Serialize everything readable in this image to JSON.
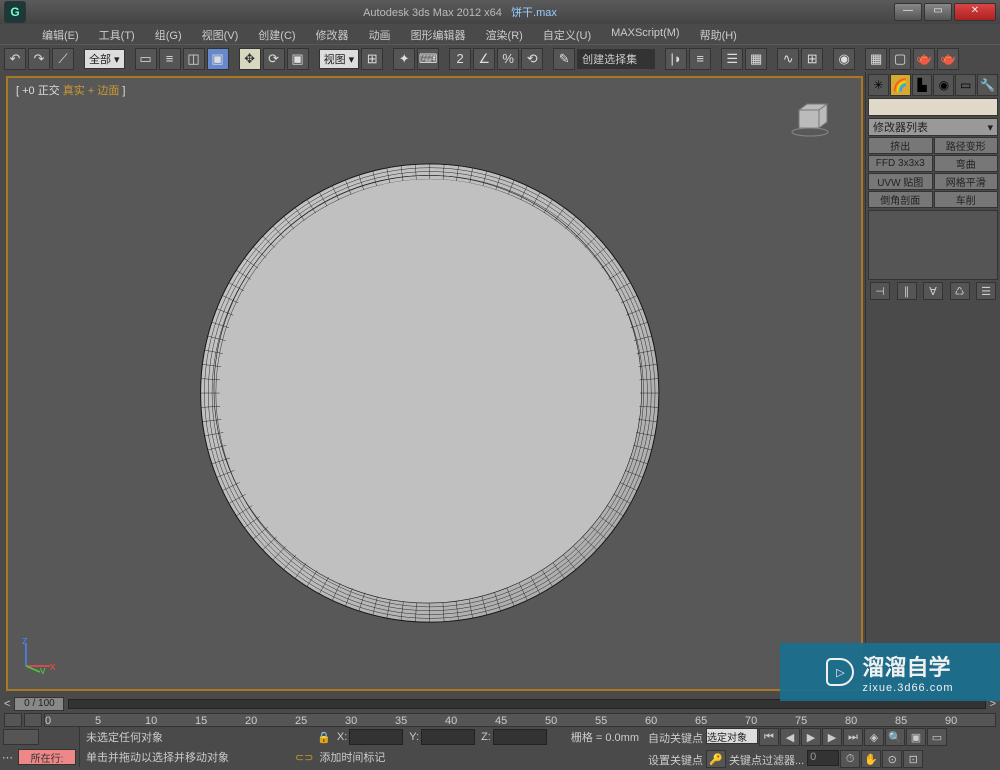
{
  "title": {
    "app": "Autodesk 3ds Max  2012 x64",
    "file": "饼干.max"
  },
  "menu": [
    "编辑(E)",
    "工具(T)",
    "组(G)",
    "视图(V)",
    "创建(C)",
    "修改器",
    "动画",
    "图形编辑器",
    "渲染(R)",
    "自定义(U)",
    "MAXScript(M)",
    "帮助(H)"
  ],
  "toolbar": {
    "filter_label": "全部 ▾",
    "viewtype_label": "视图 ▾",
    "selset_label": "创建选择集",
    "selset_dark": true
  },
  "viewport": {
    "label_prefix": "[ +0 正交  ",
    "label_gold": "真实 + 边面",
    "label_suffix": " ]"
  },
  "panel": {
    "list_header": "修改器列表",
    "mods": [
      "挤出",
      "路径变形",
      "FFD 3x3x3",
      "弯曲",
      "UVW 贴图",
      "网格平滑",
      "倒角剖面",
      "车削"
    ]
  },
  "time": {
    "slider_text": "0 / 100"
  },
  "ruler_ticks": [
    "0",
    "5",
    "10",
    "15",
    "20",
    "25",
    "30",
    "35",
    "40",
    "45",
    "50",
    "55",
    "60",
    "65",
    "70",
    "75",
    "80",
    "85",
    "90"
  ],
  "status": {
    "prompt1": "未选定任何对象",
    "prompt2": "单击并拖动以选择并移动对象",
    "add_tag": "添加时间标记",
    "x": "X:",
    "y": "Y:",
    "z": "Z:",
    "grid_label": "栅格 = 0.0mm",
    "pink_btn": "所在行:",
    "auto_key": "自动关键点",
    "set_key": "设置关键点",
    "sel_drop": "选定对象",
    "filter_label": "关键点过滤器..."
  },
  "watermark": {
    "brand": "溜溜自学",
    "url": "zixue.3d66.com"
  }
}
